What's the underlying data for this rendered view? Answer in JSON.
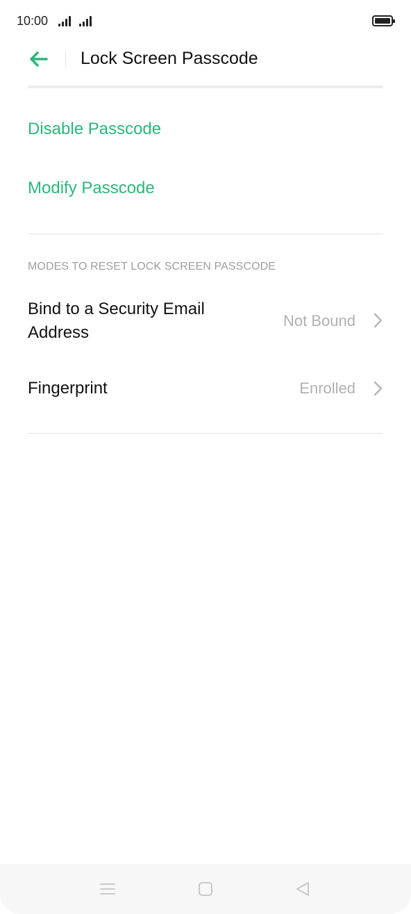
{
  "status_bar": {
    "time": "10:00",
    "icons": [
      "signal-icon",
      "signal-icon",
      "battery-icon"
    ]
  },
  "header": {
    "title": "Lock Screen Passcode",
    "back_icon": "arrow-left-icon"
  },
  "actions": {
    "disable_label": "Disable Passcode",
    "modify_label": "Modify Passcode"
  },
  "reset_modes": {
    "section_title": "MODES TO RESET LOCK SCREEN PASSCODE",
    "items": [
      {
        "label": "Bind to a Security Email Address",
        "value": "Not Bound",
        "icon": "chevron-right-icon"
      },
      {
        "label": "Fingerprint",
        "value": "Enrolled",
        "icon": "chevron-right-icon"
      }
    ]
  },
  "nav_bar": {
    "icons": [
      "menu-icon",
      "home-icon",
      "back-triangle-icon"
    ]
  },
  "colors": {
    "accent": "#2db67a",
    "text_primary": "#111111",
    "text_secondary": "#b0b0b0",
    "section_header": "#9e9e9e",
    "divider": "#e3e3e3",
    "nav_background": "#f7f7f7"
  }
}
